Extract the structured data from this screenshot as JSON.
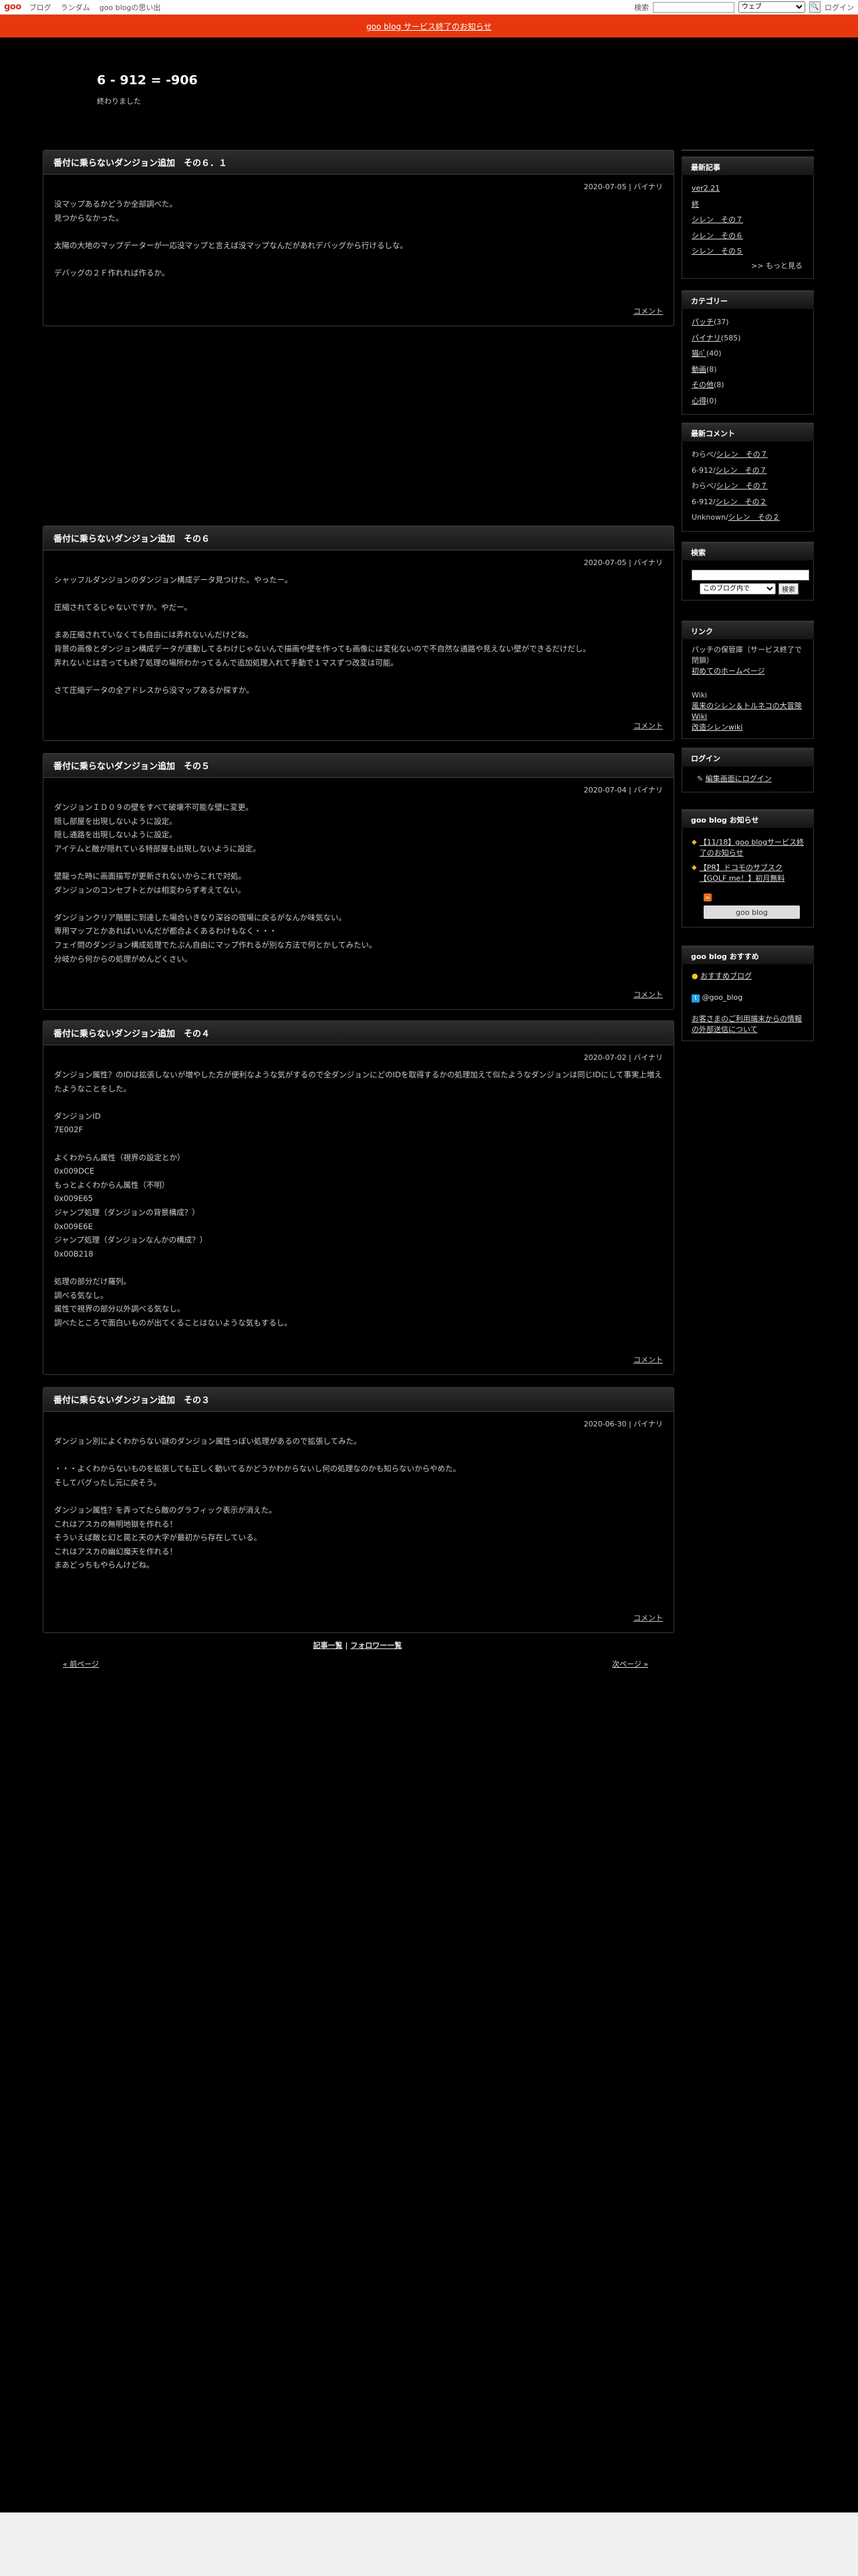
{
  "goobar": {
    "logo": "goo",
    "links": [
      "ブログ",
      "ランダム",
      "goo blogの思い出"
    ],
    "search_label": "検索",
    "search_value": "",
    "scope": "ウェブ",
    "login": "ログイン"
  },
  "notice": "goo blog サービス終了のお知らせ",
  "blog": {
    "title": "6 - 912 = -906",
    "description": "終わりました"
  },
  "posts": [
    {
      "title": "番付に乗らないダンジョン追加　その６．１",
      "meta": "2020-07-05 | バイナリ",
      "lines": [
        "没マップあるかどうか全部調べた。",
        "見つからなかった。",
        "",
        "太陽の大地のマップデーターが一応没マップと言えば没マップなんだがあれデバッグから行けるしな。",
        "",
        "デバッグの２Ｆ作れれば作るか。"
      ],
      "footer": "コメント"
    },
    {
      "title": "番付に乗らないダンジョン追加　その６",
      "meta": "2020-07-05 | バイナリ",
      "lines": [
        "シャッフルダンジョンのダンジョン構成データ見つけた。やったー。",
        "",
        "圧縮されてるじゃないですか。やだー。",
        "",
        "まあ圧縮されていなくても自由には弄れないんだけどね。",
        "背景の画像とダンジョン構成データが連動してるわけじゃないんで描画や壁を作っても画像には変化ないので不自然な通路や見えない壁ができるだけだし。",
        "弄れないとは言っても終了処理の場所わかってるんで追加処理入れて手動で１マスずつ改変は可能。",
        "",
        "さて圧縮データの全アドレスから没マップあるか探すか。"
      ],
      "footer": "コメント"
    },
    {
      "title": "番付に乗らないダンジョン追加　その５",
      "meta": "2020-07-04 | バイナリ",
      "lines": [
        "ダンジョンＩＤ０９の壁をすべて破壊不可能な壁に変更。",
        "隠し部屋を出現しないように設定。",
        "隠し通路を出現しないように設定。",
        "アイテムと敵が隠れている特部屋も出現しないように設定。",
        "",
        "壁龍った時に画面描写が更新されないからこれで対処。",
        "ダンジョンのコンセプトとかは相変わらず考えてない。",
        "",
        "ダンジョンクリア階層に到達した場合いきなり深谷の宿場に戻るがなんか味気ない。",
        "専用マップとかあればいいんだが都合よくあるわけもなく・・・",
        "フェイ問のダンジョン構成処理でたぶん自由にマップ作れるが別な方法で何とかしてみたい。",
        "分岐から何からの処理がめんどくさい。"
      ],
      "footer": "コメント"
    },
    {
      "title": "番付に乗らないダンジョン追加　その４",
      "meta": "2020-07-02 | バイナリ",
      "lines": [
        "ダンジョン属性？のIDは拡張しないが増やした方が便利なような気がするので全ダンジョンにどのIDを取得するかの処理加えて似たようなダンジョンは同じIDにして事実上増えたようなことをした。",
        "",
        "ダンジョンID",
        "7E002F",
        "",
        "よくわからん属性（視界の設定とか）",
        "0x009DCE",
        "もっとよくわからん属性（不明）",
        "0x009E65",
        "ジャンプ処理（ダンジョンの背景構成？）",
        "0x009E6E",
        "ジャンプ処理（ダンジョンなんかの構成？）",
        "0x00B218",
        "",
        "処理の部分だけ羅列。",
        "調べる気なし。",
        "属性で視界の部分以外調べる気なし。",
        "調べたところで面白いものが出てくることはないような気もするし。"
      ],
      "footer": "コメント"
    },
    {
      "title": "番付に乗らないダンジョン追加　その３",
      "meta": "2020-06-30 | バイナリ",
      "lines": [
        "ダンジョン別によくわからない謎のダンジョン属性っぽい処理があるので拡張してみた。",
        "",
        "・・・よくわからないものを拡張しても正しく動いてるかどうかわからないし何の処理なのかも知らないからやめた。",
        "そしてバグったし元に戻そう。",
        "",
        "ダンジョン属性？を弄ってたら敵のグラフィック表示が消えた。",
        "これはアスカの無明地獄を作れる！",
        "そういえば敵と幻と罠と天の大字が最初から存在している。",
        "これはアスカの幽幻魔天を作れる！",
        "まあどっちもやらんけどね。"
      ],
      "footer": "コメント"
    }
  ],
  "pagination": {
    "list": "記事一覧",
    "sep": " | ",
    "follow": "フォロワー一覧",
    "newer": "« 前ページ",
    "older": "次ページ »"
  },
  "sidebar": {
    "recent": {
      "heading": "最新記事",
      "items": [
        "ver2.21",
        "終",
        "シレン　その７",
        "シレン　その６",
        "シレン　その５"
      ],
      "more": ">> もっと見る"
    },
    "category": {
      "heading": "カテゴリー",
      "items": [
        {
          "name": "パッチ",
          "count": "(37)"
        },
        {
          "name": "バイナリ",
          "count": "(585)"
        },
        {
          "name": "猫ﾊﾞ",
          "count": "(40)"
        },
        {
          "name": "動画",
          "count": "(8)"
        },
        {
          "name": "その他",
          "count": "(8)"
        },
        {
          "name": "心得",
          "count": "(0)"
        }
      ]
    },
    "comments": {
      "heading": "最新コメント",
      "items": [
        {
          "who": "わらべ/",
          "title": "シレン　その７"
        },
        {
          "who": "6-912/",
          "title": "シレン　その７"
        },
        {
          "who": "わらべ/",
          "title": "シレン　その７"
        },
        {
          "who": "6-912/",
          "title": "シレン　その２"
        },
        {
          "who": "Unknown/",
          "title": "シレン　その２"
        }
      ]
    },
    "search": {
      "heading": "検索",
      "value": "",
      "scope": "このブログ内で",
      "button": "検索"
    },
    "links": {
      "heading": "リンク",
      "text1": "パッチの保管庫（サービス終了で閉鎖）",
      "link1": "初めてのホームページ",
      "text2": "Wiki",
      "link2": "風来のシレン＆トルネコの大冒険 Wiki",
      "link3": "改造シレンwiki"
    },
    "login": {
      "heading": "ログイン",
      "link": "編集画面にログイン"
    },
    "goo_notice": {
      "heading": "goo blog お知らせ",
      "items": [
        "【11/18】goo blogサービス終了のお知らせ",
        "【PR】ドコモのサブスク【GOLF me！】初月無料"
      ],
      "badge": "goo blog"
    },
    "recommend": {
      "heading": "goo blog おすすめ",
      "link": "おすすめブログ",
      "twitter": "@goo_blog",
      "footer_link": "お客さまのご利用端末からの情報の外部送信について"
    }
  },
  "colors": {
    "accent": "#e8360e",
    "background": "#000000",
    "text": "#dddddd"
  }
}
